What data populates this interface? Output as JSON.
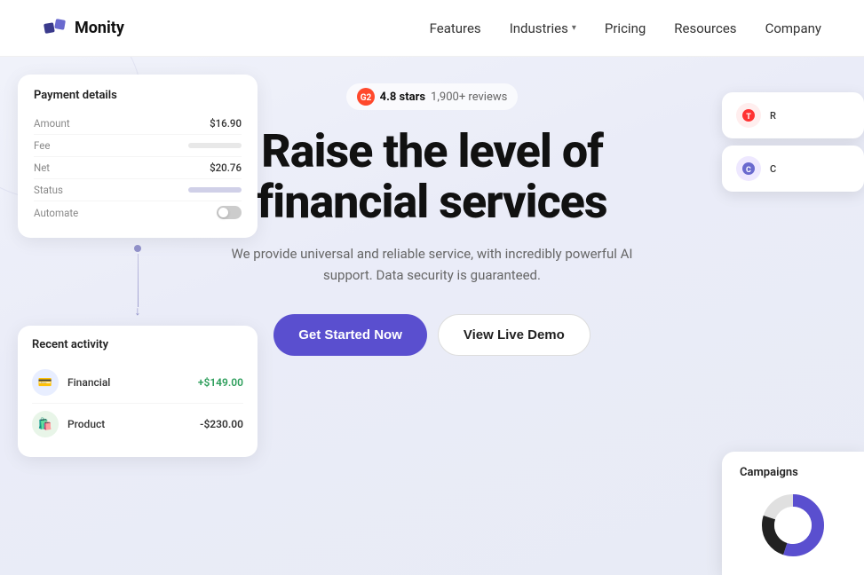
{
  "navbar": {
    "logo_text": "Monity",
    "nav_items": [
      {
        "label": "Features",
        "has_dropdown": false
      },
      {
        "label": "Industries",
        "has_dropdown": true
      },
      {
        "label": "Pricing",
        "has_dropdown": false
      },
      {
        "label": "Resources",
        "has_dropdown": false
      },
      {
        "label": "Company",
        "has_dropdown": false
      }
    ]
  },
  "hero": {
    "rating": {
      "stars": "4.8 stars",
      "reviews": "1,900+ reviews"
    },
    "title_line1": "Raise the level of",
    "title_line2": "financial services",
    "subtitle": "We provide universal and reliable service, with incredibly powerful AI support. Data security is guaranteed.",
    "cta_primary": "Get Started Now",
    "cta_secondary": "View Live Demo"
  },
  "payment_card": {
    "title": "Payment details",
    "rows": [
      {
        "label": "Amount",
        "value": "$16.90",
        "type": "text"
      },
      {
        "label": "Fee",
        "value": null,
        "type": "bar"
      },
      {
        "label": "Net",
        "value": "$20.76",
        "type": "text"
      },
      {
        "label": "Status",
        "value": null,
        "type": "bar"
      },
      {
        "label": "Automate",
        "value": null,
        "type": "toggle"
      }
    ]
  },
  "recent_activity": {
    "title": "Recent activity",
    "items": [
      {
        "name": "Financial",
        "amount": "+$149.00",
        "positive": true,
        "icon": "💳",
        "icon_color": "blue"
      },
      {
        "name": "Product",
        "amount": "-$230.00",
        "positive": false,
        "icon": "🛍️",
        "icon_color": "green"
      }
    ]
  },
  "right_notifications": [
    {
      "text": "R",
      "icon_color": "red"
    },
    {
      "text": "C",
      "icon_color": "purple"
    }
  ],
  "campaigns": {
    "title": "Campaigns",
    "donut": {
      "segments": [
        {
          "color": "#5a4fcf",
          "percentage": 55
        },
        {
          "color": "#222",
          "percentage": 25
        },
        {
          "color": "#e0e0e0",
          "percentage": 20
        }
      ]
    }
  }
}
